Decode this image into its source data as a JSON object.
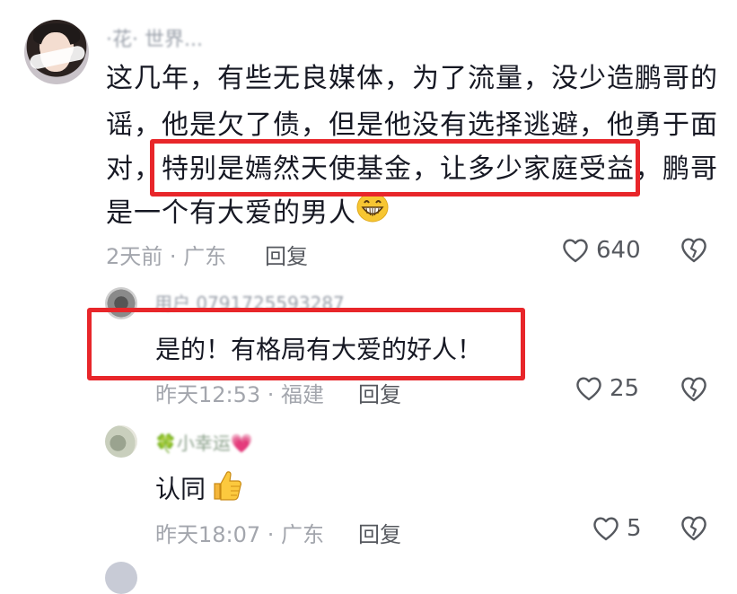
{
  "main_comment": {
    "username": "·花· 世界...",
    "text_line1": "这几年，有些无良媒体，为了流量，没少造鹏哥的",
    "text_line2": "谣，他是欠了债，但是他没有选择逃避，他勇于面",
    "text_line3_a": "对，",
    "text_line3_highlight": "特别是嫣然天使基金，让多少家庭受益，",
    "text_line3_b": "鹏哥",
    "text_line4": "是一个有大爱的男人",
    "emoji": "grinning-face",
    "meta": "2天前 · 广东",
    "reply_label": "回复",
    "likes": "640"
  },
  "replies": [
    {
      "username": "用户 0791725593287",
      "text": "是的！有格局有大爱的好人！",
      "meta": "昨天12:53 · 福建",
      "reply_label": "回复",
      "likes": "25"
    },
    {
      "username": "🍀小幸运💗",
      "text": "认同",
      "emoji": "thumbs-up",
      "meta": "昨天18:07 · 广东",
      "reply_label": "回复",
      "likes": "5"
    }
  ],
  "colors": {
    "highlight_border": "#e8262a",
    "meta_text": "#a3a6ad",
    "body_text": "#161823"
  }
}
